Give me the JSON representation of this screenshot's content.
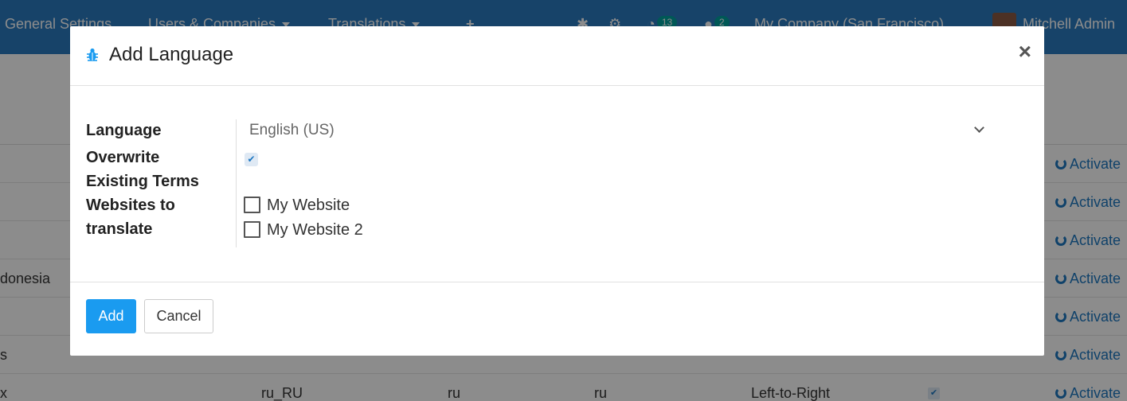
{
  "topbar": {
    "menu_general": "General Settings",
    "menu_users": "Users & Companies",
    "menu_translations": "Translations",
    "menu_plus": "+",
    "activity_count": "13",
    "messages_count": "2",
    "company": "My Company (San Francisco)",
    "user": "Mitchell Admin"
  },
  "background_rows": [
    {
      "name": "",
      "code": "",
      "iso": "",
      "url": "",
      "direction": "",
      "action": "Activate"
    },
    {
      "name": "",
      "code": "",
      "iso": "",
      "url": "",
      "direction": "",
      "action": "Activate"
    },
    {
      "name": "",
      "code": "",
      "iso": "",
      "url": "",
      "direction": "",
      "action": "Activate"
    },
    {
      "name": "donesia",
      "code": "",
      "iso": "",
      "url": "",
      "direction": "",
      "action": "Activate"
    },
    {
      "name": "",
      "code": "",
      "iso": "",
      "url": "",
      "direction": "",
      "action": "Activate"
    },
    {
      "name": "s",
      "code": "",
      "iso": "",
      "url": "",
      "direction": "",
      "action": "Activate"
    },
    {
      "name": "x",
      "code": "ru_RU",
      "iso": "ru",
      "url": "ru",
      "direction": "Left-to-Right",
      "action": "Activate"
    }
  ],
  "dialog": {
    "title": "Add Language",
    "close": "×",
    "language_label": "Language",
    "language_value": "English (US)",
    "overwrite_label_1": "Overwrite",
    "overwrite_label_2": "Existing Terms",
    "overwrite_checked": true,
    "websites_label_1": "Websites to",
    "websites_label_2": "translate",
    "websites": [
      {
        "label": "My Website",
        "checked": false
      },
      {
        "label": "My Website 2",
        "checked": false
      }
    ],
    "add_button": "Add",
    "cancel_button": "Cancel"
  },
  "colors": {
    "topbar": "#2b7bc0",
    "primary": "#1a9bf0",
    "link": "#1e78c2"
  },
  "icons": {
    "debug": "bug-icon",
    "close": "close-icon",
    "refresh": "refresh-icon",
    "dropdown": "chevron-down-icon"
  }
}
